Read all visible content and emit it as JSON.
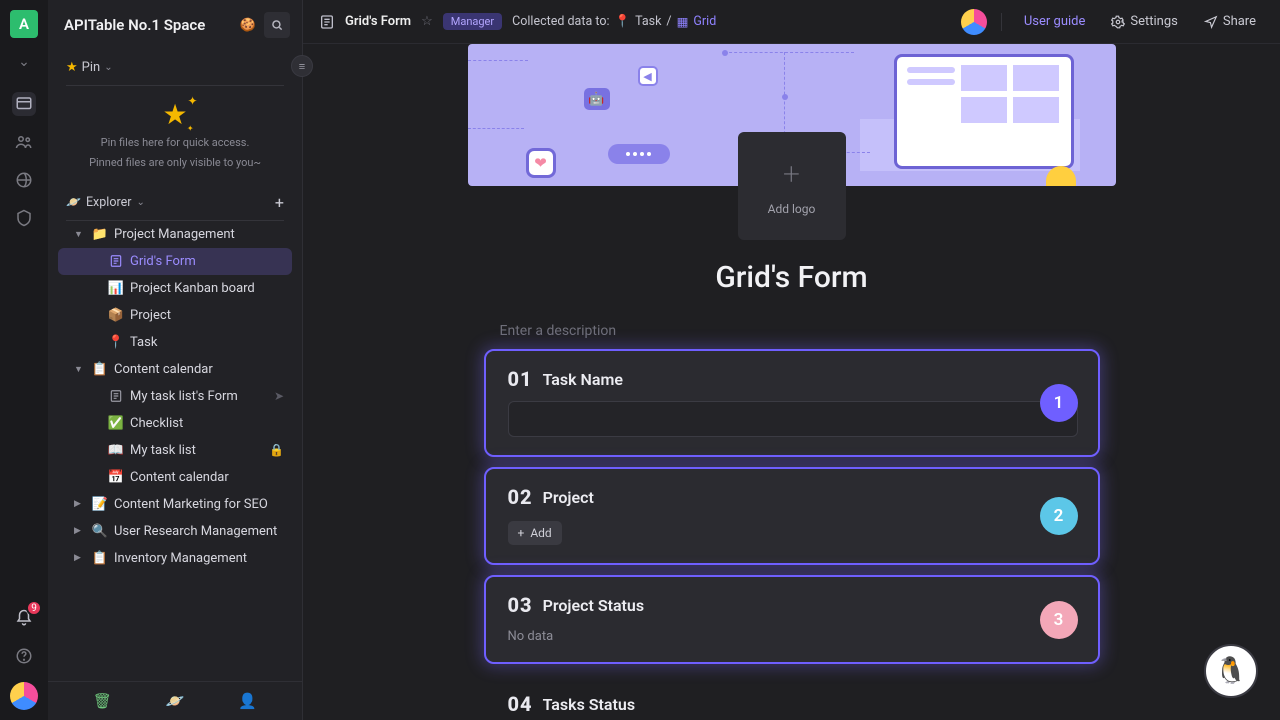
{
  "workspace": {
    "initial": "A",
    "name": "APITable No.1 Space"
  },
  "search": {
    "tooltip": "Search"
  },
  "pin": {
    "label": "Pin",
    "hint1": "Pin files here for quick access.",
    "hint2": "Pinned files are only visible to you~"
  },
  "explorer": {
    "label": "Explorer"
  },
  "tree": {
    "pm": {
      "label": "Project Management"
    },
    "gridsform": {
      "label": "Grid's Form"
    },
    "kanban": {
      "label": "Project Kanban board"
    },
    "project": {
      "label": "Project"
    },
    "task": {
      "label": "Task"
    },
    "cc": {
      "label": "Content calendar"
    },
    "mytasklistform": {
      "label": "My task list's Form"
    },
    "checklist": {
      "label": "Checklist"
    },
    "mytasklist": {
      "label": "My task list"
    },
    "contentcal": {
      "label": "Content calendar"
    },
    "seo": {
      "label": "Content Marketing for SEO"
    },
    "urm": {
      "label": "User Research Management"
    },
    "inv": {
      "label": "Inventory Management"
    }
  },
  "notif": {
    "count": "9"
  },
  "topbar": {
    "title": "Grid's Form",
    "role": "Manager",
    "collected_label": "Collected data to:",
    "task": "Task",
    "grid": "Grid",
    "userguide": "User guide",
    "settings": "Settings",
    "share": "Share"
  },
  "form": {
    "add_logo": "Add logo",
    "title": "Grid's Form",
    "desc_placeholder": "Enter a description",
    "f1_num": "01",
    "f1_label": "Task Name",
    "f2_num": "02",
    "f2_label": "Project",
    "f2_add": "Add",
    "f3_num": "03",
    "f3_label": "Project Status",
    "f3_text": "No data",
    "f4_num": "04",
    "f4_label": "Tasks Status",
    "step1": "1",
    "step2": "2",
    "step3": "3"
  }
}
